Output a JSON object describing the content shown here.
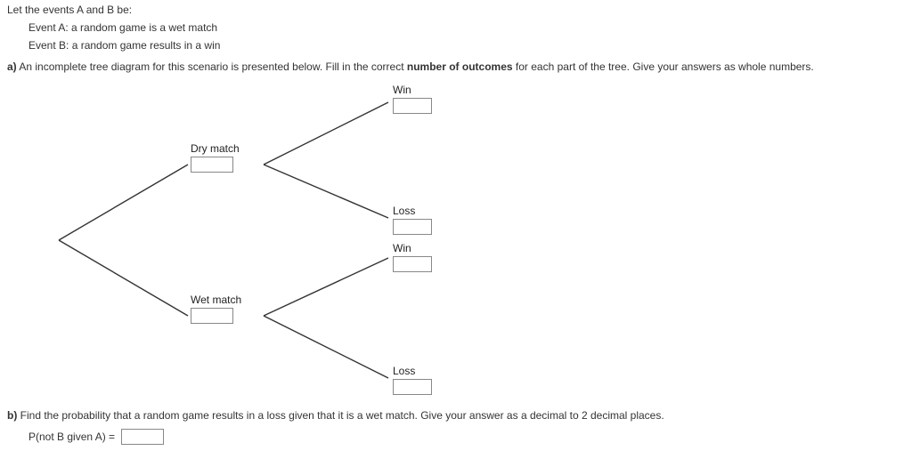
{
  "intro": {
    "lead": "Let the events A and B be:",
    "eventA": "Event A: a random game is a wet match",
    "eventB": "Event B: a random game results in a win"
  },
  "partA": {
    "label": "a)",
    "text_before_bold": "An incomplete tree diagram for this scenario is presented below. Fill in the correct ",
    "bold": "number of outcomes",
    "text_after_bold": " for each part of the tree. Give your answers as whole numbers."
  },
  "tree": {
    "level1": {
      "top": {
        "label": "Dry match",
        "value": ""
      },
      "bottom": {
        "label": "Wet match",
        "value": ""
      }
    },
    "level2": {
      "dry_win": {
        "label": "Win",
        "value": ""
      },
      "dry_loss": {
        "label": "Loss",
        "value": ""
      },
      "wet_win": {
        "label": "Win",
        "value": ""
      },
      "wet_loss": {
        "label": "Loss",
        "value": ""
      }
    }
  },
  "partB": {
    "label": "b)",
    "text": "Find the probability that a random game results in a loss given that it is a wet match. Give your answer as a decimal to 2 decimal places.",
    "answer_label": "P(not B given A) =",
    "answer_value": ""
  }
}
